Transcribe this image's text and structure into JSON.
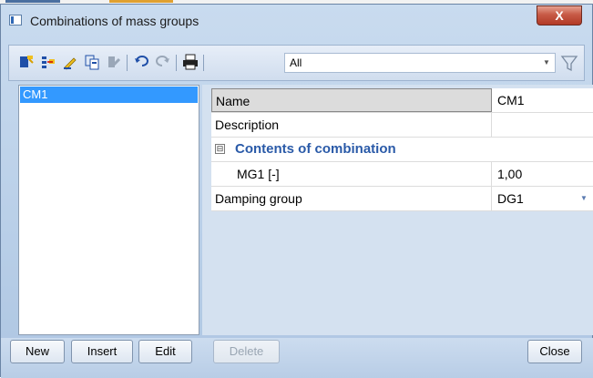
{
  "window": {
    "title": "Combinations of mass groups",
    "close_label": "X"
  },
  "toolbar": {
    "icons": [
      "new-item-icon",
      "insert-icon",
      "edit-icon",
      "copy-icon",
      "delete-icon",
      "undo-icon",
      "redo-icon",
      "print-icon",
      "filter-icon"
    ],
    "filter_value": "All"
  },
  "list": {
    "items": [
      "CM1"
    ]
  },
  "properties": {
    "name_label": "Name",
    "name_value": "CM1",
    "description_label": "Description",
    "description_value": "",
    "section_label": "Contents of combination",
    "section_toggle": "⊟",
    "mg1_label": "MG1 [-]",
    "mg1_value": "1,00",
    "damping_label": "Damping group",
    "damping_value": "DG1"
  },
  "footer": {
    "new_label": "New",
    "insert_label": "Insert",
    "edit_label": "Edit",
    "delete_label": "Delete",
    "close_label": "Close"
  }
}
